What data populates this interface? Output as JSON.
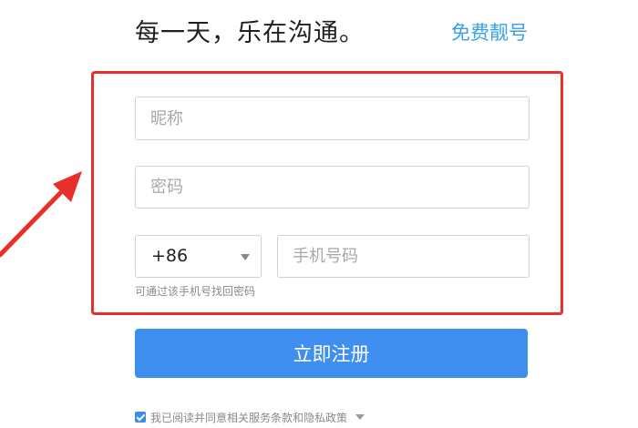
{
  "header": {
    "slogan": "每一天，乐在沟通。",
    "free_link": "免费靓号"
  },
  "form": {
    "nickname": {
      "placeholder": "昵称",
      "value": ""
    },
    "password": {
      "placeholder": "密码",
      "value": ""
    },
    "country_code": "+86",
    "phone": {
      "placeholder": "手机号码",
      "value": ""
    },
    "phone_hint": "可通过该手机号找回密码",
    "register_label": "立即注册",
    "agreement": {
      "checked": true,
      "text": "我已阅读并同意相关服务条款和隐私政策"
    }
  },
  "colors": {
    "accent": "#3f8ff0",
    "link": "#3aa0e6",
    "annotation_red": "#e8302a"
  },
  "icons": {
    "dropdown": "chevron-down-icon",
    "annotation": "red-arrow-icon"
  }
}
